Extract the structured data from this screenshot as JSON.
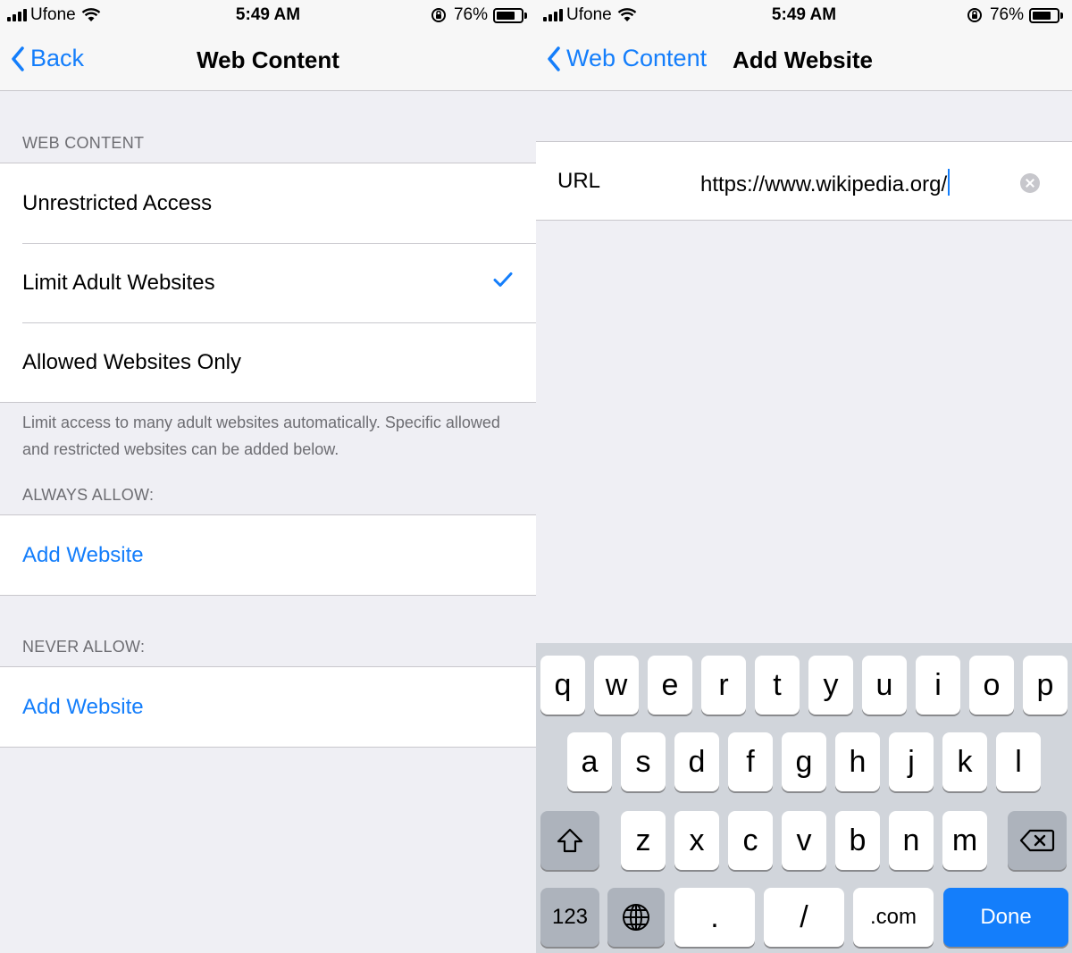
{
  "status_bar": {
    "carrier": "Ufone",
    "time": "5:49 AM",
    "battery_percent": "76%",
    "battery_level": 0.76
  },
  "left_screen": {
    "nav": {
      "back_label": "Back",
      "title": "Web Content"
    },
    "web_content": {
      "header": "WEB CONTENT",
      "options": [
        {
          "label": "Unrestricted Access",
          "selected": false
        },
        {
          "label": "Limit Adult Websites",
          "selected": true
        },
        {
          "label": "Allowed Websites Only",
          "selected": false
        }
      ],
      "footer": "Limit access to many adult websites automatically. Specific allowed and restricted websites can be added below."
    },
    "always_allow": {
      "header": "ALWAYS ALLOW:",
      "add_label": "Add Website"
    },
    "never_allow": {
      "header": "NEVER ALLOW:",
      "add_label": "Add Website"
    }
  },
  "right_screen": {
    "nav": {
      "back_label": "Web Content",
      "title": "Add Website"
    },
    "url_field": {
      "label": "URL",
      "value": "https://www.wikipedia.org/"
    },
    "keyboard": {
      "row1": [
        "q",
        "w",
        "e",
        "r",
        "t",
        "y",
        "u",
        "i",
        "o",
        "p"
      ],
      "row2": [
        "a",
        "s",
        "d",
        "f",
        "g",
        "h",
        "j",
        "k",
        "l"
      ],
      "row3": [
        "z",
        "x",
        "c",
        "v",
        "b",
        "n",
        "m"
      ],
      "numbers_label": "123",
      "period_label": ".",
      "slash_label": "/",
      "dotcom_label": ".com",
      "done_label": "Done"
    }
  },
  "colors": {
    "accent": "#147efb",
    "background": "#efeff4",
    "separator": "#c8c7cc",
    "secondary_text": "#6d6d72",
    "keyboard_bg": "#d1d5db"
  },
  "icons": [
    "signal-icon",
    "wifi-icon",
    "orientation-lock-icon",
    "battery-icon",
    "chevron-left-icon",
    "checkmark-icon",
    "clear-icon",
    "shift-icon",
    "delete-icon",
    "globe-icon"
  ]
}
